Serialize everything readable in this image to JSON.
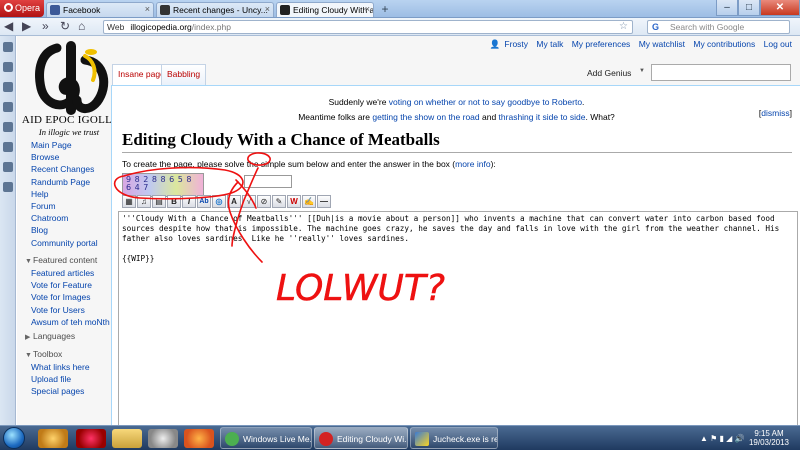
{
  "browser": {
    "menu_label": "Opera",
    "tabs": [
      {
        "label": "Facebook",
        "active": false
      },
      {
        "label": "Recent changes - Uncy...",
        "active": false
      },
      {
        "label": "Editing Cloudy With a ...",
        "active": true
      }
    ],
    "address_label": "Web",
    "address_domain": "illogicopedia.org",
    "address_path": "/index.php",
    "search_placeholder": "Search with Google"
  },
  "site": {
    "logo_title": "AID EPOC IGOLLI",
    "logo_tagline": "In illogic we trust"
  },
  "personal": {
    "user": "Frosty",
    "links": [
      "My talk",
      "My preferences",
      "My watchlist",
      "My contributions",
      "Log out"
    ]
  },
  "page_tabs": {
    "main": "Insane page",
    "talk": "Babbling",
    "action": "Add Genius"
  },
  "sidebar": {
    "nav": [
      "Main Page",
      "Browse",
      "Recent Changes",
      "Randumb Page",
      "Help",
      "Forum",
      "Chatroom",
      "Blog",
      "Community portal"
    ],
    "featured_heading": "Featured content",
    "featured": [
      "Featured articles",
      "Vote for Feature",
      "Vote for Images",
      "Vote for Users",
      "Awsum of teh moNth"
    ],
    "languages_heading": "Languages",
    "toolbox_heading": "Toolbox",
    "toolbox": [
      "What links here",
      "Upload file",
      "Special pages"
    ]
  },
  "notice": {
    "line1_prefix": "Suddenly we're ",
    "line1_link": "voting on whether or not to say goodbye to Roberto",
    "line1_suffix": ".",
    "line2_prefix": "Meantime folks are ",
    "line2_link1": "getting the show on the road",
    "line2_mid": " and ",
    "line2_link2": "thrashing it side to side",
    "line2_suffix": ". What?",
    "dismiss": "dismiss"
  },
  "editor": {
    "title": "Editing Cloudy With a Chance of Meatballs",
    "captcha_prefix": "To create the page, please solve the simple sum below and enter the answer in the box (",
    "captcha_link": "more info",
    "captcha_suffix": "):",
    "captcha_digits": "9 8 2 8 8 6 5 8 6 4 7",
    "text": "'''Cloudy With a Chance of Meatballs''' [[Duh|is a movie about a person]] who invents a machine that can convert water into carbon based food sources despite how that is impossible. The machine goes crazy, he saves the day and falls in love with the girl from the weather channel. His father also loves sardines. Like he ''really'' loves sardines.\n\n{{WIP}}"
  },
  "scribble_text": "LOLWUT?",
  "taskbar": {
    "items": [
      {
        "label": "Windows Live Me...",
        "active": false
      },
      {
        "label": "Editing Cloudy Wi...",
        "active": true
      },
      {
        "label": "Jucheck.exe is req...",
        "active": false
      }
    ],
    "time": "9:15 AM",
    "date": "19/03/2013"
  }
}
